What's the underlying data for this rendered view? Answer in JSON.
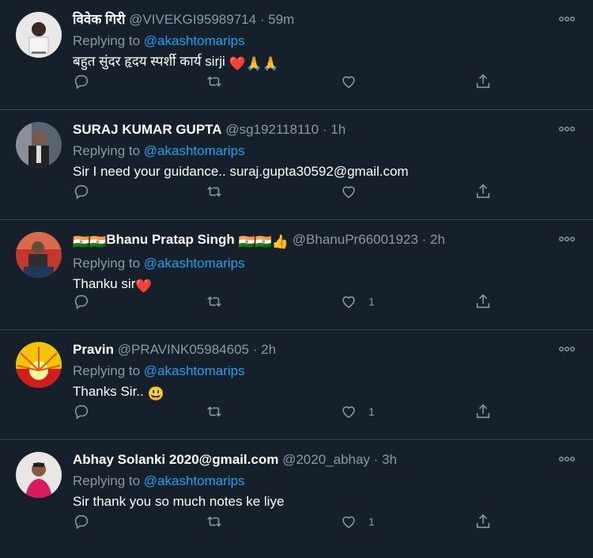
{
  "tweets": [
    {
      "name": "विवेक गिरी",
      "handle": "@VIVEKGI95989714",
      "time": "59m",
      "replying_prefix": "Replying to ",
      "replying_to": "@akashtomarips",
      "text": "बहुत सुंदर हृदय स्पर्शी कार्य sirji ",
      "emojis": [
        "❤️",
        "🙏",
        "🙏"
      ],
      "like_count": ""
    },
    {
      "name": "SURAJ KUMAR GUPTA",
      "handle": "@sg192118110",
      "time": "1h",
      "replying_prefix": "Replying to ",
      "replying_to": "@akashtomarips",
      "text": "Sir I need your guidance.. suraj.gupta30592@gmail.com",
      "emojis": [],
      "like_count": ""
    },
    {
      "name": "Bhanu Pratap Singh",
      "name_prefix_emojis": [
        "🇮🇳",
        "🇮🇳"
      ],
      "name_suffix_emojis": [
        "🇮🇳",
        "🇮🇳",
        "👍"
      ],
      "handle": "@BhanuPr66001923",
      "time": "2h",
      "replying_prefix": "Replying to ",
      "replying_to": "@akashtomarips",
      "text": "Thanku sir",
      "emojis": [
        "❤️"
      ],
      "like_count": "1"
    },
    {
      "name": "Pravin",
      "handle": "@PRAVINK05984605",
      "time": "2h",
      "replying_prefix": "Replying to ",
      "replying_to": "@akashtomarips",
      "text": "Thanks Sir.. ",
      "emojis": [
        "😃"
      ],
      "like_count": "1"
    },
    {
      "name": "Abhay Solanki 2020@gmail.com",
      "handle": "@2020_abhay",
      "time": "3h",
      "replying_prefix": "Replying to ",
      "replying_to": "@akashtomarips",
      "text": "Sir thank you so much notes ke liye",
      "emojis": [],
      "like_count": "1"
    }
  ],
  "dot": "·",
  "icons": {
    "reply": "reply-icon",
    "retweet": "retweet-icon",
    "like": "heart-icon",
    "share": "share-icon",
    "more": "more-icon"
  },
  "colors": {
    "background": "#15202b",
    "divider": "#38444d",
    "secondary_text": "#8899a6",
    "mention": "#1da1f2",
    "heart_emoji": "#e0245e"
  }
}
